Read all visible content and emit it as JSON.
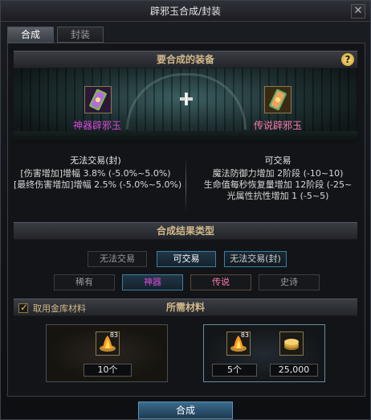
{
  "window": {
    "title": "辟邪玉合成/封装",
    "close_icon": "close-icon"
  },
  "tabs": [
    {
      "label": "合成",
      "active": true
    },
    {
      "label": "封装",
      "active": false
    }
  ],
  "required": {
    "header": "要合成的装备",
    "help": "?",
    "left_item": {
      "name": "神器辟邪玉",
      "icon": "jade-icon"
    },
    "right_item": {
      "name": "传说辟邪玉",
      "icon": "jade-icon"
    }
  },
  "stats": {
    "left": {
      "title": "无法交易(封)",
      "lines": [
        "[伤害增加]增幅 3.8% (-5.0%~5.0%)",
        "[最终伤害增加]增幅 2.5% (-5.0%~5.0%)"
      ]
    },
    "right": {
      "title": "可交易",
      "lines": [
        "魔法防御力增加 2阶段 (-10~10)",
        "生命值每秒恢复量增加 12阶段 (-25~",
        "光属性抗性增加 1 (-5~5)"
      ]
    }
  },
  "result": {
    "header": "合成结果类型",
    "trade_options": [
      "无法交易",
      "可交易",
      "无法交易(封)"
    ],
    "rarity_options": [
      "稀有",
      "神器",
      "传说",
      "史诗"
    ]
  },
  "materials": {
    "checkbox_label": "取用金库材料",
    "checked": true,
    "header": "所需材料",
    "box1": {
      "stack": "83",
      "count": "10个"
    },
    "box2": {
      "stack": "83",
      "count": "5个",
      "gold": "25,000"
    }
  },
  "compose_button": "合成",
  "colors": {
    "epic_purple": "#d64ad6",
    "legend_pink": "#ff7ab0",
    "header_gold": "#d2b98a"
  }
}
